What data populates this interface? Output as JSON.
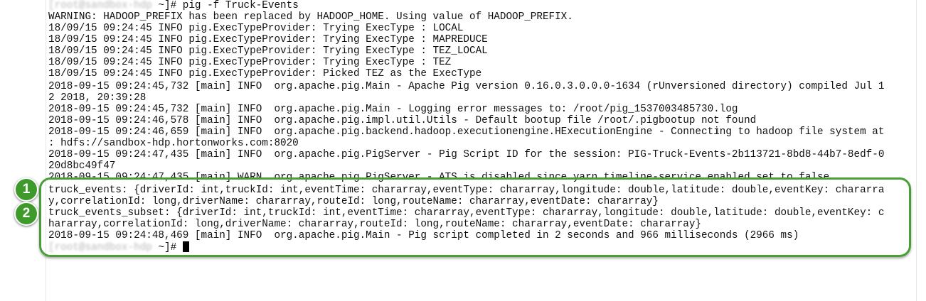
{
  "terminal": {
    "command_line": {
      "prompt_user_host": "[root@sandbox-hdp",
      "prompt_suffix": " ~]# ",
      "command": "pig -f Truck-Events"
    },
    "output_lines": [
      "WARNING: HADOOP_PREFIX has been replaced by HADOOP_HOME. Using value of HADOOP_PREFIX.",
      "18/09/15 09:24:45 INFO pig.ExecTypeProvider: Trying ExecType : LOCAL",
      "18/09/15 09:24:45 INFO pig.ExecTypeProvider: Trying ExecType : MAPREDUCE",
      "18/09/15 09:24:45 INFO pig.ExecTypeProvider: Trying ExecType : TEZ_LOCAL",
      "18/09/15 09:24:45 INFO pig.ExecTypeProvider: Trying ExecType : TEZ",
      "18/09/15 09:24:45 INFO pig.ExecTypeProvider: Picked TEZ as the ExecType",
      "2018-09-15 09:24:45,732 [main] INFO  org.apache.pig.Main - Apache Pig version 0.16.0.3.0.0.0-1634 (rUnversioned directory) compiled Jul 1",
      "2 2018, 20:39:28",
      "2018-09-15 09:24:45,732 [main] INFO  org.apache.pig.Main - Logging error messages to: /root/pig_1537003485730.log",
      "2018-09-15 09:24:46,578 [main] INFO  org.apache.pig.impl.util.Utils - Default bootup file /root/.pigbootup not found",
      "2018-09-15 09:24:46,659 [main] INFO  org.apache.pig.backend.hadoop.executionengine.HExecutionEngine - Connecting to hadoop file system at",
      ": hdfs://sandbox-hdp.hortonworks.com:8020",
      "2018-09-15 09:24:47,435 [main] INFO  org.apache.pig.PigServer - Pig Script ID for the session: PIG-Truck-Events-2b113721-8bd8-44b7-8edf-0",
      "20d8bc49f47",
      "2018-09-15 09:24:47,435 [main] WARN  org.apache.pig.PigServer - ATS is disabled since yarn.timeline-service.enabled set to false",
      "truck_events: {driverId: int,truckId: int,eventTime: chararray,eventType: chararray,longitude: double,latitude: double,eventKey: chararra",
      "y,correlationId: long,driverName: chararray,routeId: long,routeName: chararray,eventDate: chararray}",
      "truck_events_subset: {driverId: int,truckId: int,eventTime: chararray,eventType: chararray,longitude: double,latitude: double,eventKey: c",
      "hararray,correlationId: long,driverName: chararray,routeId: long,routeName: chararray,eventDate: chararray}",
      "2018-09-15 09:24:48,469 [main] INFO  org.apache.pig.Main - Pig script completed in 2 seconds and 966 milliseconds (2966 ms)"
    ],
    "final_prompt": {
      "prompt_user_host": "[root@sandbox-hdp",
      "prompt_suffix": " ~]# "
    }
  },
  "annotations": {
    "callout_1": "1",
    "callout_2": "2",
    "highlight_color": "#4a9e37",
    "callout_color": "#3f9a2c"
  }
}
